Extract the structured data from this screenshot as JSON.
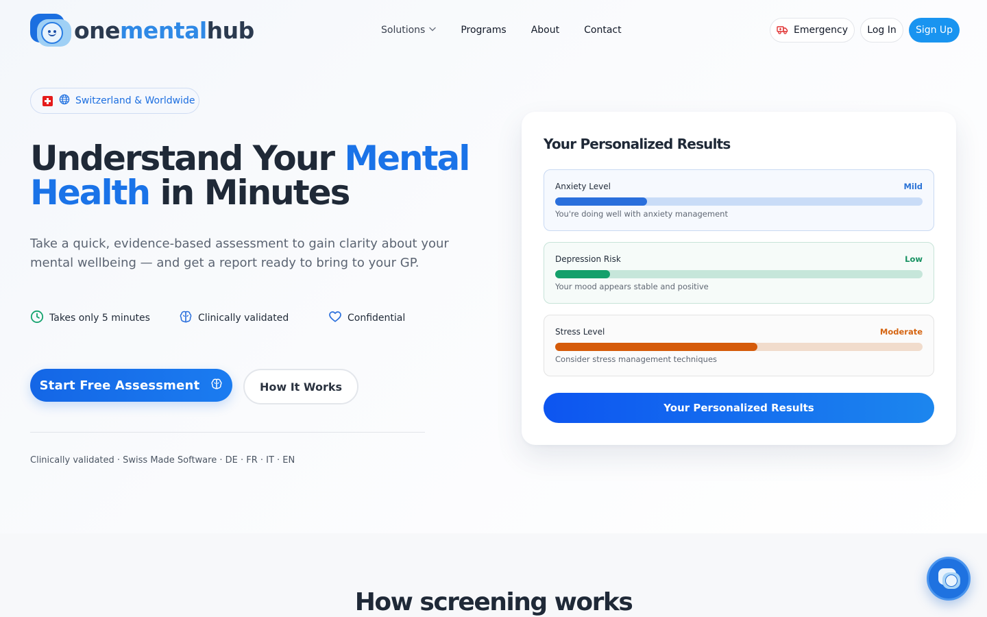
{
  "brand": {
    "part1": "one",
    "part2": "mental",
    "part3": "hub"
  },
  "nav": {
    "solutions": "Solutions",
    "programs": "Programs",
    "about": "About",
    "contact": "Contact"
  },
  "header_actions": {
    "emergency": "Emergency",
    "login": "Log In",
    "signup": "Sign Up"
  },
  "hero": {
    "region": "Switzerland & Worldwide",
    "title_part1": "Understand Your ",
    "title_accent1": "Mental",
    "title_accent2": "Health",
    "title_part2": " in Minutes",
    "subtitle": "Take a quick, evidence-based assessment to gain clarity about your mental wellbeing — and get a report ready to bring to your GP.",
    "features": [
      {
        "label": "Takes only 5 minutes",
        "icon": "clock-icon"
      },
      {
        "label": "Clinically validated",
        "icon": "brain-icon"
      },
      {
        "label": "Confidential",
        "icon": "heart-icon"
      }
    ],
    "cta_primary": "Start Free Assessment",
    "cta_secondary": "How It Works",
    "footnote": "Clinically validated · Swiss Made Software · DE · FR · IT · EN"
  },
  "results_card": {
    "title": "Your Personalized Results",
    "metrics": [
      {
        "name": "Anxiety Level",
        "level": "Mild",
        "progress": 0.25,
        "description": "You're doing well with anxiety management",
        "color": "#2a6fdc"
      },
      {
        "name": "Depression Risk",
        "level": "Low",
        "progress": 0.15,
        "description": "Your mood appears stable and positive",
        "color": "#14a06b"
      },
      {
        "name": "Stress Level",
        "level": "Moderate",
        "progress": 0.55,
        "description": "Consider stress management techniques",
        "color": "#d55b0a"
      }
    ],
    "button": "Your Personalized Results"
  },
  "section": {
    "title": "How screening works"
  },
  "colors": {
    "primary": "#1a73e8",
    "signup": "#1994f0",
    "text": "#1f2937"
  }
}
